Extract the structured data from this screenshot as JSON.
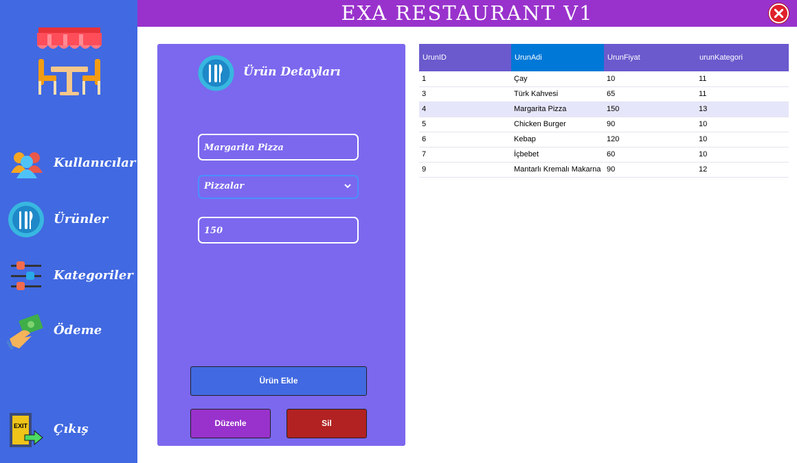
{
  "app": {
    "title": "EXA RESTAURANT V1"
  },
  "sidebar": {
    "items": [
      {
        "label": "Kullanıcılar",
        "icon": "users-icon"
      },
      {
        "label": "Ürünler",
        "icon": "cutlery-icon"
      },
      {
        "label": "Kategoriler",
        "icon": "sliders-icon"
      },
      {
        "label": "Ödeme",
        "icon": "payment-icon"
      },
      {
        "label": "Çıkış",
        "icon": "exit-icon"
      }
    ]
  },
  "panel": {
    "title": "Ürün Detayları",
    "product_name": "Margarita Pizza",
    "category": "Pizzalar",
    "price": "150",
    "add_label": "Ürün Ekle",
    "edit_label": "Düzenle",
    "delete_label": "Sil"
  },
  "grid": {
    "columns": [
      "UrunID",
      "UrunAdi",
      "UrunFiyat",
      "urunKategori"
    ],
    "rows": [
      [
        "1",
        "Çay",
        "10",
        "11"
      ],
      [
        "3",
        "Türk Kahvesi",
        "65",
        "11"
      ],
      [
        "4",
        "Margarita Pizza",
        "150",
        "13"
      ],
      [
        "5",
        "Chicken Burger",
        "90",
        "10"
      ],
      [
        "6",
        "Kebap",
        "120",
        "10"
      ],
      [
        "7",
        "İçbebet",
        "60",
        "10"
      ],
      [
        "9",
        "Mantarlı Kremalı Makarna",
        "90",
        "12"
      ]
    ],
    "selected_row": 2
  },
  "colors": {
    "sidebar": "#4169E1",
    "titlebar": "#9932CC",
    "panel": "#7B68EE",
    "grid_header": "#6A5ACD",
    "delete": "#B22222"
  }
}
